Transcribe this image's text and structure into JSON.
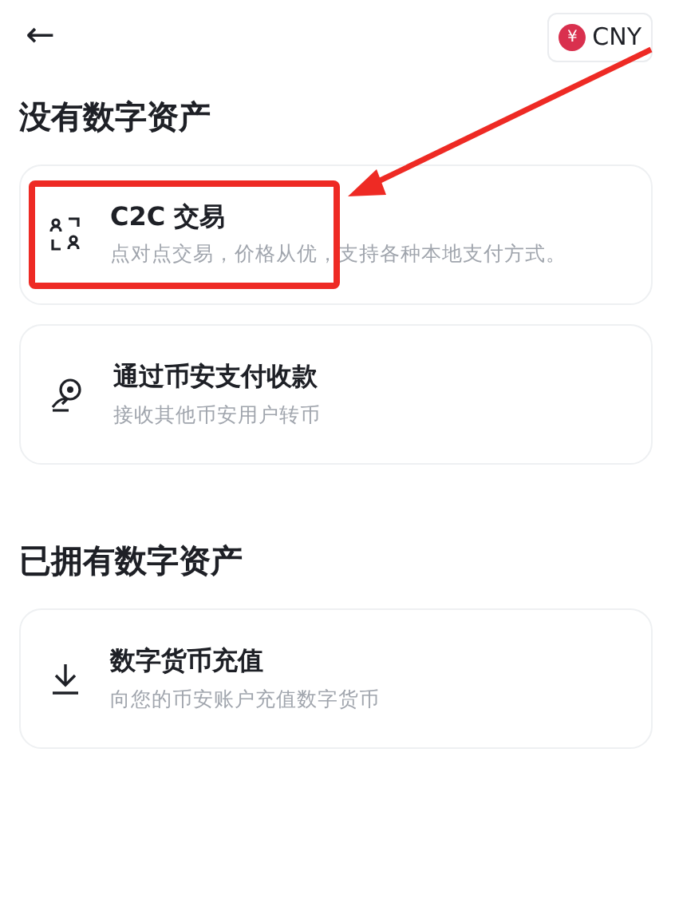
{
  "header": {
    "back": "←",
    "currency": {
      "symbol": "¥",
      "code": "CNY"
    }
  },
  "sections": [
    {
      "title": "没有数字资产",
      "items": [
        {
          "kind": "c2c",
          "title": "C2C 交易",
          "description": "点对点交易，价格从优，支持各种本地支付方式。",
          "highlighted": true
        },
        {
          "kind": "pay",
          "title": "通过币安支付收款",
          "description": "接收其他币安用户转币",
          "highlighted": false
        }
      ]
    },
    {
      "title": "已拥有数字资产",
      "items": [
        {
          "kind": "deposit",
          "title": "数字货币充值",
          "description": "向您的币安账户充值数字货币",
          "highlighted": false
        }
      ]
    }
  ]
}
